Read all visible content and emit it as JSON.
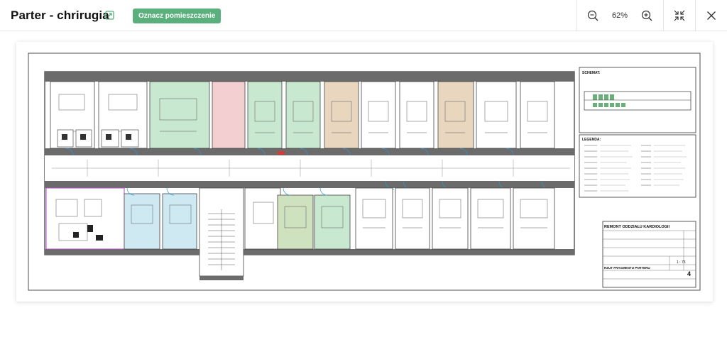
{
  "header": {
    "title": "Parter - chrirugia",
    "mark_button_label": "Oznacz pomieszczenie"
  },
  "toolbar": {
    "zoom_level": "62%"
  },
  "drawing": {
    "schema_label": "SCHEMAT:",
    "legend_label": "LEGENDA:",
    "project_title": "REMONT ODDZIAŁU KARDIOLOGII",
    "sheet_subtitle": "RZUT FRAGMENTU PARTERU",
    "scale": "1 : 75",
    "sheet_number": "4"
  },
  "colors": {
    "accent_green": "#5aaf7c",
    "room_green": "#c8e8cf",
    "room_red": "#f3cfd2",
    "room_tan": "#e8d7be",
    "room_blue": "#cfe9f3",
    "room_olive": "#cfe2c0"
  }
}
